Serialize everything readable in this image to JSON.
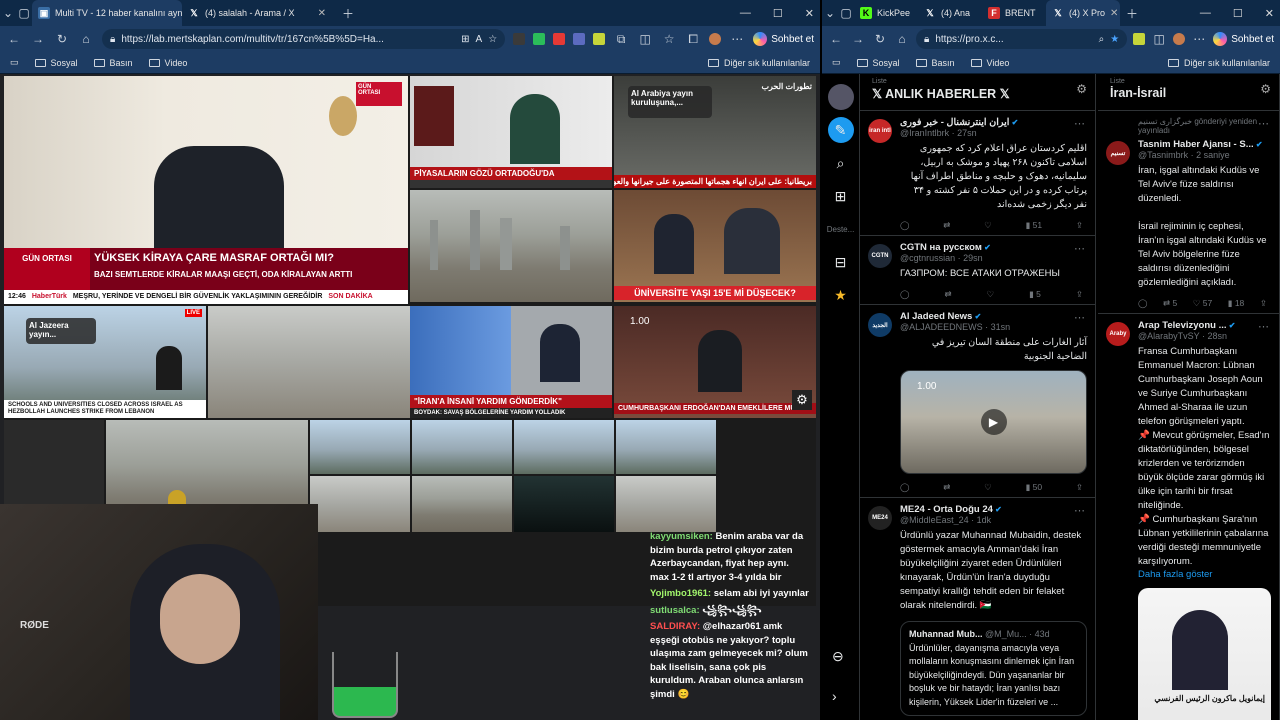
{
  "left": {
    "tabs": [
      {
        "label": "Multi TV - 12 haber kanalını aynı a",
        "icon": "browser-tab-icon"
      },
      {
        "label": "(4) salalah - Arama / X",
        "icon": "x-logo-icon"
      }
    ],
    "url": "https://lab.mertskaplan.com/multitv/tr/167cn%5B%5D=Ha...",
    "copilot": "Sohbet et",
    "favorites": [
      "Sosyal",
      "Basın",
      "Video"
    ],
    "favorites_other": "Diğer sık kullanılanlar",
    "tiles": {
      "t1_top": "GÜN ORTASI",
      "t1_headline": "YÜKSEK KİRAYA ÇARE MASRAF ORTAĞI MI?",
      "t1_sub": "BAZI SEMTLERDE KİRALAR MAAŞI GEÇTİ, ODA KİRALAYAN ARTTI",
      "t1_ticker": "MEŞRU, YERİNDE VE DENGELİ BİR GÜVENLİK YAKLAŞIMININ GEREĞİDİR",
      "t1_time": "12:46",
      "t1_brand": "HaberTürk",
      "t1_live": "SON DAKİKA",
      "t2_headline": "PİYASALARIN GÖZÜ ORTADOĞU'DA",
      "t3_overlay": "Al Arabiya yayın kuruluşuna,...",
      "t3_brand": "تطورات الحرب",
      "t3_ticker": "بريطانيا: على ايران انهاء هجماتها المتصورة على جيرانها والعودة الى الدبلوماسية",
      "t5_headline": "ÜNİVERSİTE YAŞI 15'E Mİ DÜŞECEK?",
      "t6_overlay": "Al Jazeera yayın...",
      "t6_ticker": "SCHOOLS AND UNIVERSITIES CLOSED ACROSS ISRAEL AS HEZBOLLAH LAUNCHES STRIKE FROM LEBANON",
      "t8_headline": "\"İRAN'A İNSANİ YARDIM GÖNDERDİK\"",
      "t8_sub": "BOYDAK: SAVAŞ BÖLGELERİNE YARDIM YOLLADIK",
      "t9_time": "1.00",
      "t9_headline": "CUMHURBAŞKANI ERDOĞAN'DAN EMEKLİLERE MÜJDE"
    },
    "webcam_mic": "RØDE",
    "chat": [
      {
        "user": "kayyumsiken:",
        "text": "Benim araba var da bizim burda petrol çıkıyor zaten Azerbaycandan, fiyat hep aynı. max 1-2 tl artıyor 3-4 yılda bir",
        "cls": "u1"
      },
      {
        "user": "Yojimbo1961:",
        "text": "selam abi iyi yayınlar",
        "cls": "u2"
      },
      {
        "user": "sutlusalca:",
        "text": "꧁꧂꧁꧂",
        "cls": "u1"
      },
      {
        "user": "SALDIRAY:",
        "text": "@elhazar061 amk eşşeği otobüs ne yakıyor? toplu ulaşıma zam gelmeyecek mi? olum bak liselisin, sana çok pis kuruldum. Araban olunca anlarsın şimdi 😊",
        "cls": "u3"
      }
    ]
  },
  "right": {
    "tabs": [
      {
        "label": "KickPee",
        "icon": "kick-icon"
      },
      {
        "label": "(4) Ana",
        "icon": "x-logo-icon"
      },
      {
        "label": "BRENT",
        "icon": "brent-icon"
      },
      {
        "label": "(4) X Pro",
        "icon": "x-logo-icon"
      }
    ],
    "url": "https://pro.x.c...",
    "copilot": "Sohbet et",
    "favorites": [
      "Sosyal",
      "Basın",
      "Video"
    ],
    "favorites_other": "Diğer sık kullanılanlar",
    "col1": {
      "sub": "Liste",
      "title": "ANLIK HABERLER",
      "tweets": [
        {
          "name": "ایران اینترنشنال - خبر فوری",
          "handle": "@IranIntlbrk · 27sn",
          "body": "اقلیم کردستان عراق اعلام کرد که جمهوری اسلامی تاکنون ۲۶۸ پهپاد و موشک به اربیل، سلیمانیه، دهوک و حلبچه و مناطق اطراف آنها پرتاب کرده و در این حملات ۵ نفر کشته و ۳۴ نفر دیگر زخمی شده‌اند",
          "rtl": true,
          "stats": [
            "",
            "",
            "",
            "51",
            ""
          ],
          "avbg": "#c62828",
          "avtext": "iran intl"
        },
        {
          "name": "CGTN на русском",
          "handle": "@cgtnrussian · 29sn",
          "body": "ГАЗПРОМ: ВСЕ АТАКИ ОТРАЖЕНЫ",
          "rtl": false,
          "stats": [
            "",
            "",
            "",
            "5",
            ""
          ],
          "avbg": "#1f2937",
          "avtext": "CGTN"
        },
        {
          "name": "Al Jadeed News",
          "handle": "@ALJADEEDNEWS · 31sn",
          "body": "آثار الغارات على منطقة السان تيريز في الضاحية الجنوبية",
          "rtl": true,
          "video": "1.00",
          "stats": [
            "",
            "",
            "",
            "50",
            ""
          ],
          "avbg": "#0f3b66",
          "avtext": "الجديد"
        },
        {
          "name": "ME24 - Orta Doğu 24",
          "handle": "@MiddleEast_24 · 1dk",
          "body": "Ürdünlü yazar Muhannad Mubaidin, destek göstermek amacıyla Amman'daki İran büyükelçiliğini ziyaret eden Ürdünlüleri kınayarak, Ürdün'ün İran'a duyduğu sempatiyi krallığı tehdit eden bir felaket olarak nitelendirdi. 🇯🇴",
          "rtl": false,
          "quote_name": "Muhannad Mub...",
          "quote_handle": "@M_Mu... · 43d",
          "quote_body": "Ürdünlüler, dayanışma amacıyla veya mollaların konuşmasını dinlemek için İran büyükelçiliğindeydi. Dün yaşananlar bir boşluk ve bir hataydı; İran yanlısı bazı kişilerin, Yüksek Lider'in füzeleri ve ...",
          "avbg": "#222",
          "avtext": "ME24"
        }
      ]
    },
    "col2": {
      "sub": "Liste",
      "title": "İran-İsrail",
      "tweets": [
        {
          "repost": "خبرگزاری تسنیم gönderiyi yeniden yayınladı",
          "name": "Tasnim Haber Ajansı - S...",
          "handle": "@Tasnimbrk · 2 saniye",
          "body": "İran, işgal altındaki Kudüs ve Tel Aviv'e füze saldırısı düzenledi.\n\nİsrail rejiminin iç cephesi, İran'ın işgal altındaki Kudüs ve Tel Aviv bölgelerine füze saldırısı düzenlediğini gözlemlediğini açıkladı.",
          "stats": [
            "",
            "5",
            "57",
            "18",
            ""
          ],
          "avbg": "#8b1a1a",
          "avtext": "تسنیم"
        },
        {
          "name": "Arap Televizyonu ...",
          "handle": "@AlarabyTvSY · 28sn",
          "body": "Fransa Cumhurbaşkanı Emmanuel Macron: Lübnan Cumhurbaşkanı Joseph Aoun ve Suriye Cumhurbaşkanı Ahmed al-Sharaa ile uzun telefon görüşmeleri yaptı.\n📌 Mevcut görüşmeler, Esad'ın diktatörlüğünden, bölgesel krizlerden ve terörizmden büyük ölçüde zarar görmüş iki ülke için tarihi bir fırsat niteliğinde.\n📌 Cumhurbaşkanı Şara'nın Lübnan yetkililerinin çabalarına verdiği desteği memnuniyetle karşılıyorum.",
          "more_link": "Daha fazla göster",
          "img_caption": "إيمانويل ماكرون الرئيس الفرنسي",
          "avbg": "#b71c1c",
          "avtext": "Araby"
        }
      ]
    }
  }
}
